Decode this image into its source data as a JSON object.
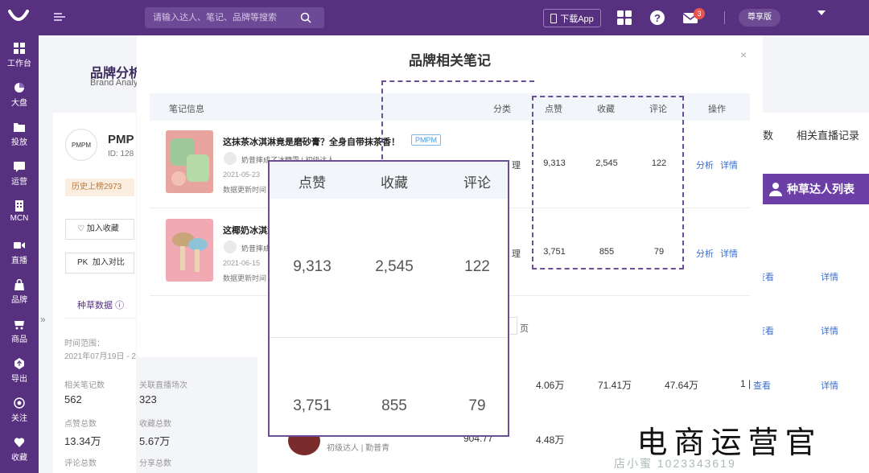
{
  "topbar": {
    "search_placeholder": "请输入达人、笔记、品牌等搜索",
    "download_app": "下载App",
    "mail_badge": "3",
    "vip_label": "尊享版",
    "colors": {
      "bar": "#57307f",
      "accent": "#6b3fa6",
      "link": "#3b6fd1"
    }
  },
  "sidebar": {
    "items": [
      {
        "label": "工作台",
        "icon": "dashboard-icon"
      },
      {
        "label": "大盘",
        "icon": "pie-chart-icon"
      },
      {
        "label": "投放",
        "icon": "folder-icon"
      },
      {
        "label": "运营",
        "icon": "message-icon"
      },
      {
        "label": "MCN",
        "icon": "building-icon"
      },
      {
        "label": "直播",
        "icon": "video-icon"
      },
      {
        "label": "品牌",
        "icon": "bag-icon"
      },
      {
        "label": "商品",
        "icon": "cart-icon"
      },
      {
        "label": "导出",
        "icon": "export-icon"
      },
      {
        "label": "关注",
        "icon": "eye-icon"
      },
      {
        "label": "收藏",
        "icon": "heart-icon"
      }
    ]
  },
  "background": {
    "title": "品牌分析",
    "subtitle": "Brand Analy",
    "brand_logo_text": "PMPM",
    "brand_name": "PMP",
    "brand_id": "ID: 128",
    "history_badge": "历史上榜2973",
    "add_favorite": "加入收藏",
    "add_compare": "加入对比",
    "pk_label": "PK",
    "tab_label": "种草数据",
    "range_label": "时间范围：",
    "range_value": "2021年07月19日 - 2",
    "stats": [
      {
        "label": "相关笔记数",
        "value": "562"
      },
      {
        "label": "关联直播场次",
        "value": "323"
      },
      {
        "label": "点赞总数",
        "value": "13.34万"
      },
      {
        "label": "收藏总数",
        "value": "5.67万"
      },
      {
        "label": "评论总数",
        "value": ""
      },
      {
        "label": "分享总数",
        "value": ""
      }
    ],
    "right_tab_partial": "数",
    "right_tab_live": "相关直播记录",
    "seed_button": "种草达人列表",
    "detail_link": "详情",
    "view_link": "查看",
    "row": {
      "v1": "4.06万",
      "v2": "71.41万",
      "v3": "47.64万",
      "count": "1 |",
      "view": "查看"
    },
    "row2": {
      "v1": "904.77",
      "v2": "4.48万",
      "author": "初级达人 | 勤普青"
    }
  },
  "modal": {
    "title": "品牌相关笔记",
    "close": "×",
    "columns": {
      "info": "笔记信息",
      "category": "分类",
      "likes": "点赞",
      "collects": "收藏",
      "comments": "评论",
      "actions": "操作"
    },
    "notes": [
      {
        "title": "这抹茶冰淇淋竟是磨砂膏？全身自带抹茶香！",
        "tag": "PMPM",
        "author": "奶昔摔成了冰糖霜 | 初级达人",
        "date": "2021-05-23",
        "update": "数据更新时间",
        "category": "理",
        "likes": "9,313",
        "collects": "2,545",
        "comments": "122",
        "analyze": "分析",
        "detail": "详情"
      },
      {
        "title": "这椰奶冰淇淋",
        "tag": "",
        "author": "奶昔摔成",
        "date": "2021-06-15",
        "update": "数据更新时间",
        "category": "理",
        "likes": "3,751",
        "collects": "855",
        "comments": "79",
        "analyze": "分析",
        "detail": "详情"
      }
    ],
    "page_unit": "页"
  },
  "zoom": {
    "headers": [
      "点赞",
      "收藏",
      "评论"
    ],
    "rows": [
      [
        "9,313",
        "2,545",
        "122"
      ],
      [
        "3,751",
        "855",
        "79"
      ]
    ]
  },
  "watermark": {
    "main": "电商运营官",
    "sub": "店小蜜 1023343619"
  }
}
